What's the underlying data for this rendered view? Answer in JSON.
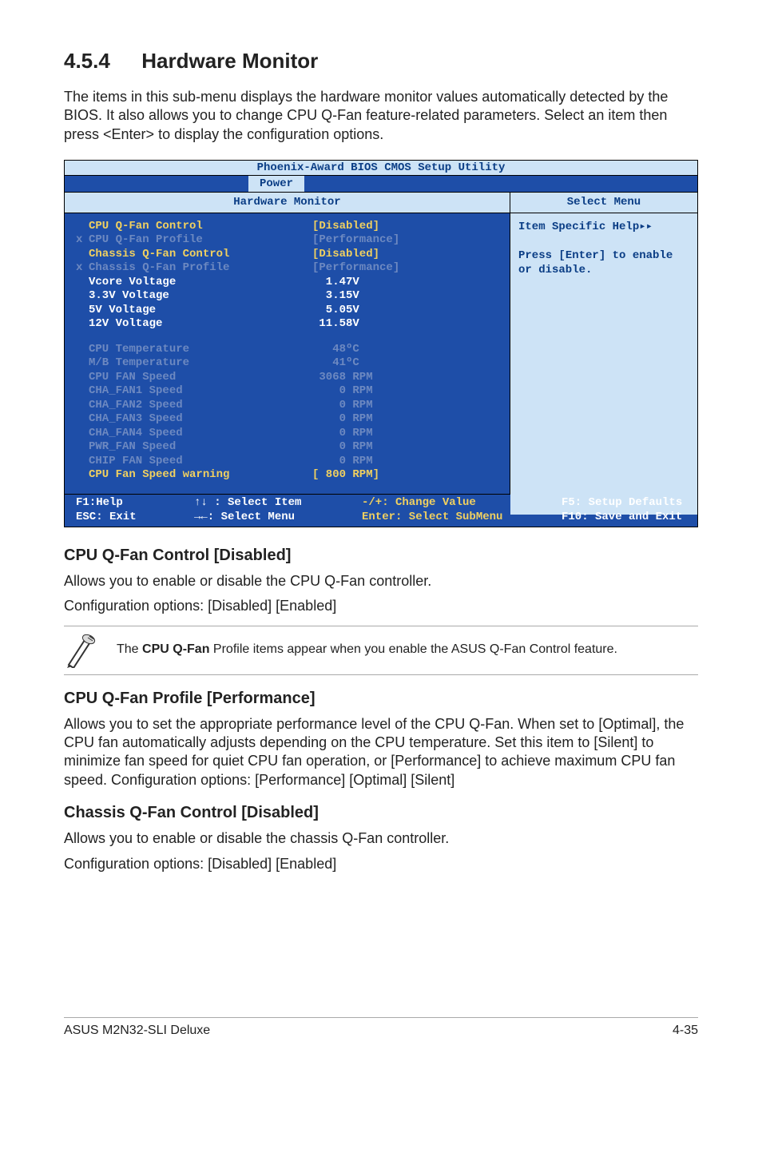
{
  "section": {
    "num": "4.5.4",
    "title": "Hardware Monitor"
  },
  "intro": "The items in this sub-menu displays the hardware monitor values automatically detected by the BIOS. It also allows you to change CPU Q-Fan feature-related parameters. Select an item then press <Enter> to display the configuration options.",
  "bios": {
    "title": "Phoenix-Award BIOS CMOS Setup Utility",
    "tab": "Power",
    "left_header": "Hardware Monitor",
    "right_header": "Select Menu",
    "rows": [
      {
        "x": "",
        "label": "CPU Q-Fan Control",
        "val": "[Disabled]",
        "dim": false,
        "yellow": true
      },
      {
        "x": "x",
        "label": "CPU Q-Fan Profile",
        "val": "[Performance]",
        "dim": true
      },
      {
        "x": "",
        "label": "Chassis Q-Fan Control",
        "val": "[Disabled]",
        "dim": false,
        "yellow": true
      },
      {
        "x": "x",
        "label": "Chassis Q-Fan Profile",
        "val": "[Performance]",
        "dim": true
      },
      {
        "x": "",
        "label": "Vcore Voltage",
        "val": "  1.47V",
        "dim": false
      },
      {
        "x": "",
        "label": "3.3V Voltage",
        "val": "  3.15V",
        "dim": false
      },
      {
        "x": "",
        "label": "5V Voltage",
        "val": "  5.05V",
        "dim": false
      },
      {
        "x": "",
        "label": "12V Voltage",
        "val": " 11.58V",
        "dim": false
      },
      {
        "spacer": true
      },
      {
        "x": "",
        "label": "CPU Temperature",
        "val": "   48ºC",
        "dim": true
      },
      {
        "x": "",
        "label": "M/B Temperature",
        "val": "   41ºC",
        "dim": true
      },
      {
        "x": "",
        "label": "CPU FAN Speed",
        "val": " 3068 RPM",
        "dim": true
      },
      {
        "x": "",
        "label": "CHA_FAN1 Speed",
        "val": "    0 RPM",
        "dim": true
      },
      {
        "x": "",
        "label": "CHA_FAN2 Speed",
        "val": "    0 RPM",
        "dim": true
      },
      {
        "x": "",
        "label": "CHA_FAN3 Speed",
        "val": "    0 RPM",
        "dim": true
      },
      {
        "x": "",
        "label": "CHA_FAN4 Speed",
        "val": "    0 RPM",
        "dim": true
      },
      {
        "x": "",
        "label": "PWR_FAN Speed",
        "val": "    0 RPM",
        "dim": true
      },
      {
        "x": "",
        "label": "CHIP FAN Speed",
        "val": "    0 RPM",
        "dim": true
      },
      {
        "x": "",
        "label": "CPU Fan Speed warning",
        "val": "[ 800 RPM]",
        "dim": false,
        "yellow": true
      }
    ],
    "help_title": "Item Specific Help",
    "help_body_pre": "Press ",
    "help_body_key": "[Enter]",
    "help_body_mid": " to ",
    "help_body_bold": "enable or disable.",
    "footer": {
      "f1a": "F1:Help",
      "f1b": "ESC: Exit",
      "f2a": "↑↓ : Select Item",
      "f2b": "→←: Select Menu",
      "f3a": "-/+: Change Value",
      "f3b": "Enter: Select SubMenu",
      "f4a": "F5: Setup Defaults",
      "f4b": "F10: Save and Exit"
    },
    "chart_data": {
      "type": "table",
      "title": "Hardware Monitor",
      "items": [
        {
          "name": "CPU Q-Fan Control",
          "value": "Disabled"
        },
        {
          "name": "CPU Q-Fan Profile",
          "value": "Performance"
        },
        {
          "name": "Chassis Q-Fan Control",
          "value": "Disabled"
        },
        {
          "name": "Chassis Q-Fan Profile",
          "value": "Performance"
        },
        {
          "name": "Vcore Voltage",
          "value": 1.47,
          "unit": "V"
        },
        {
          "name": "3.3V Voltage",
          "value": 3.15,
          "unit": "V"
        },
        {
          "name": "5V Voltage",
          "value": 5.05,
          "unit": "V"
        },
        {
          "name": "12V Voltage",
          "value": 11.58,
          "unit": "V"
        },
        {
          "name": "CPU Temperature",
          "value": 48,
          "unit": "ºC"
        },
        {
          "name": "M/B Temperature",
          "value": 41,
          "unit": "ºC"
        },
        {
          "name": "CPU FAN Speed",
          "value": 3068,
          "unit": "RPM"
        },
        {
          "name": "CHA_FAN1 Speed",
          "value": 0,
          "unit": "RPM"
        },
        {
          "name": "CHA_FAN2 Speed",
          "value": 0,
          "unit": "RPM"
        },
        {
          "name": "CHA_FAN3 Speed",
          "value": 0,
          "unit": "RPM"
        },
        {
          "name": "CHA_FAN4 Speed",
          "value": 0,
          "unit": "RPM"
        },
        {
          "name": "PWR_FAN Speed",
          "value": 0,
          "unit": "RPM"
        },
        {
          "name": "CHIP FAN Speed",
          "value": 0,
          "unit": "RPM"
        },
        {
          "name": "CPU Fan Speed warning",
          "value": 800,
          "unit": "RPM"
        }
      ]
    }
  },
  "sub1": {
    "h": "CPU Q-Fan Control [Disabled]",
    "p1": "Allows you to enable or disable the CPU Q-Fan controller.",
    "p2": "Configuration options: [Disabled] [Enabled]"
  },
  "note": {
    "pre": "The ",
    "bold": "CPU Q-Fan",
    "post": " Profile items appear when you enable the ASUS Q-Fan Control feature."
  },
  "sub2": {
    "h": "CPU Q-Fan Profile [Performance]",
    "p": "Allows you to set the appropriate performance level of the CPU Q-Fan. When set to [Optimal], the CPU fan automatically adjusts depending on the CPU temperature. Set this item to [Silent] to minimize fan speed for quiet CPU fan operation, or [Performance] to achieve maximum CPU fan speed. Configuration options: [Performance] [Optimal] [Silent]"
  },
  "sub3": {
    "h": "Chassis Q-Fan Control [Disabled]",
    "p1": "Allows you to enable or disable the chassis Q-Fan controller.",
    "p2": "Configuration options: [Disabled] [Enabled]"
  },
  "footer": {
    "left": "ASUS M2N32-SLI Deluxe",
    "right": "4-35"
  }
}
